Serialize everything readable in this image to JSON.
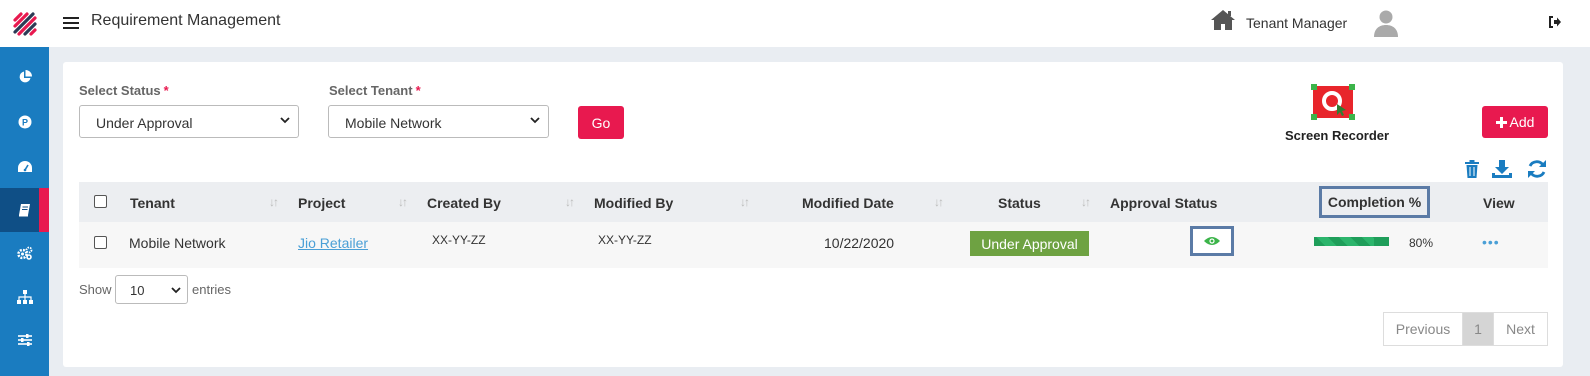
{
  "header": {
    "title": "Requirement Management",
    "user_name": "Tenant Manager"
  },
  "filters": {
    "status_label": "Select Status",
    "status_required": "*",
    "status_value": "Under Approval",
    "tenant_label": "Select Tenant",
    "tenant_required": "*",
    "tenant_value": "Mobile Network",
    "go_label": "Go"
  },
  "recorder": {
    "label": "Screen Recorder"
  },
  "add_button": {
    "label": "Add",
    "icon": "plus-icon"
  },
  "toolbar_icons": [
    "trash-icon",
    "download-icon",
    "refresh-icon"
  ],
  "sidebar": {
    "items": [
      {
        "icon": "pie-chart-icon"
      },
      {
        "icon": "parking-icon"
      },
      {
        "icon": "dashboard-icon"
      },
      {
        "icon": "book-icon",
        "active": true
      },
      {
        "icon": "gears-icon"
      },
      {
        "icon": "sitemap-icon"
      },
      {
        "icon": "sliders-icon"
      }
    ]
  },
  "table": {
    "columns": [
      "Tenant",
      "Project",
      "Created By",
      "Modified By",
      "Modified Date",
      "Status",
      "Approval Status",
      "Completion %",
      "View"
    ],
    "rows": [
      {
        "tenant": "Mobile Network",
        "project": "Jio Retailer",
        "created_by": "XX-YY-ZZ",
        "modified_by": "XX-YY-ZZ",
        "modified_date": "10/22/2020",
        "status": "Under Approval",
        "approval_icon": "eye-icon",
        "completion": "80%",
        "completion_value": 0.8,
        "view": "•••"
      }
    ]
  },
  "length": {
    "show": "Show",
    "value": "10",
    "entries": "entries"
  },
  "pagination": {
    "previous": "Previous",
    "current": "1",
    "next": "Next"
  },
  "colors": {
    "sidebar": "#1a7cc0",
    "accent": "#e8194f",
    "status_badge": "#6ea242",
    "progress": "#1f9e5a",
    "link": "#4a9fd6"
  }
}
